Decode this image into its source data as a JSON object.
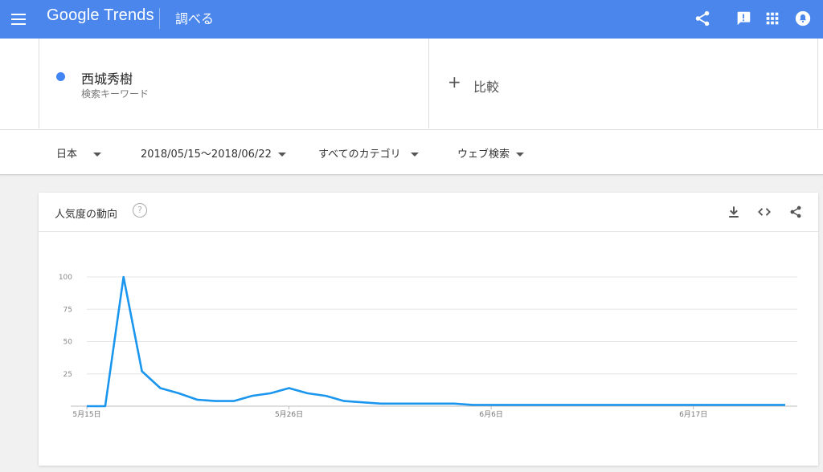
{
  "header": {
    "logo": "Google Trends",
    "section": "調べる",
    "icons": [
      "menu-icon",
      "share-icon",
      "feedback-icon",
      "apps-icon",
      "notifications-icon"
    ]
  },
  "term": {
    "name": "西城秀樹",
    "type": "検索キーワード",
    "color": "#4285f4"
  },
  "compare": {
    "label": "比較"
  },
  "filters": {
    "region": "日本",
    "date_range": "2018/05/15〜2018/06/22",
    "category": "すべてのカテゴリ",
    "search_type": "ウェブ検索"
  },
  "card": {
    "title": "人気度の動向",
    "help": "?",
    "icons": [
      "download-icon",
      "embed-icon",
      "share-icon"
    ]
  },
  "chart_data": {
    "type": "line",
    "title": "",
    "xlabel": "",
    "ylabel": "",
    "ylim": [
      0,
      100
    ],
    "yticks": [
      25,
      50,
      75,
      100
    ],
    "x_ticks": [
      "5月15日",
      "5月26日",
      "6月6日",
      "6月17日"
    ],
    "x_tick_indices": [
      0,
      11,
      22,
      33
    ],
    "x": [
      "2018-05-15",
      "2018-05-16",
      "2018-05-17",
      "2018-05-18",
      "2018-05-19",
      "2018-05-20",
      "2018-05-21",
      "2018-05-22",
      "2018-05-23",
      "2018-05-24",
      "2018-05-25",
      "2018-05-26",
      "2018-05-27",
      "2018-05-28",
      "2018-05-29",
      "2018-05-30",
      "2018-05-31",
      "2018-06-01",
      "2018-06-02",
      "2018-06-03",
      "2018-06-04",
      "2018-06-05",
      "2018-06-06",
      "2018-06-07",
      "2018-06-08",
      "2018-06-09",
      "2018-06-10",
      "2018-06-11",
      "2018-06-12",
      "2018-06-13",
      "2018-06-14",
      "2018-06-15",
      "2018-06-16",
      "2018-06-17",
      "2018-06-18",
      "2018-06-19",
      "2018-06-20",
      "2018-06-21",
      "2018-06-22"
    ],
    "series": [
      {
        "name": "西城秀樹",
        "color": "#1a96ee",
        "values": [
          0,
          0,
          100,
          27,
          14,
          10,
          5,
          4,
          4,
          8,
          10,
          14,
          10,
          8,
          4,
          3,
          2,
          2,
          2,
          2,
          2,
          1,
          1,
          1,
          1,
          1,
          1,
          1,
          1,
          1,
          1,
          1,
          1,
          1,
          1,
          1,
          1,
          1,
          1
        ]
      }
    ],
    "grid": true,
    "legend": "none"
  }
}
